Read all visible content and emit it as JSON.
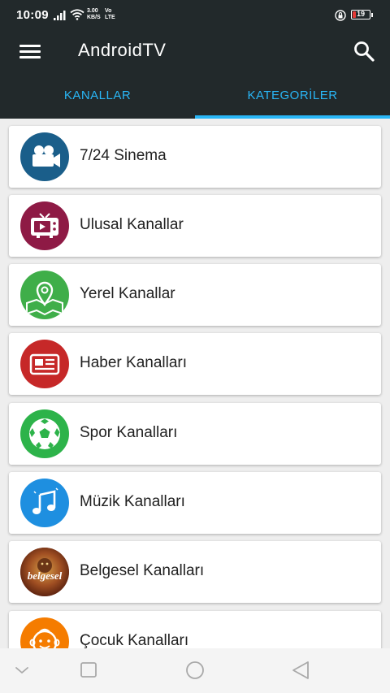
{
  "status_bar": {
    "time": "10:09",
    "net_speed_value": "3.00",
    "net_speed_unit": "KB/S",
    "volte_top": "Vo",
    "volte_bottom": "LTE",
    "battery_level": "19",
    "battery_color": "#e53935"
  },
  "app_bar": {
    "title": "AndroidTV",
    "menu_icon": "hamburger-menu-icon",
    "search_icon": "search-icon",
    "background": "#22292b"
  },
  "tabs": [
    {
      "label": "KANALLAR",
      "selected": false
    },
    {
      "label": "KATEGORİLER",
      "selected": true
    }
  ],
  "accent_color": "#29b6f6",
  "categories": [
    {
      "label": "7/24 Sinema",
      "icon": "movie-camera-icon",
      "color": "#1a5e8a"
    },
    {
      "label": "Ulusal Kanallar",
      "icon": "tv-icon",
      "color": "#8e1a45"
    },
    {
      "label": "Yerel Kanallar",
      "icon": "map-pin-icon",
      "color": "#3fae49"
    },
    {
      "label": "Haber Kanalları",
      "icon": "newspaper-icon",
      "color": "#c62828"
    },
    {
      "label": "Spor Kanalları",
      "icon": "soccer-ball-icon",
      "color": "#2db34a"
    },
    {
      "label": "Müzik Kanalları",
      "icon": "music-note-icon",
      "color": "#1e8fe0"
    },
    {
      "label": "Belgesel Kanalları",
      "icon": "belgesel-logo-icon",
      "logo_text": "belgesel",
      "color": "#8a3a1f"
    },
    {
      "label": "Çocuk Kanalları",
      "icon": "child-face-icon",
      "color": "#f57c00"
    }
  ],
  "nav_bar": {
    "buttons": [
      "chevron-down-icon",
      "recents-square-icon",
      "home-circle-icon",
      "back-triangle-icon"
    ]
  }
}
